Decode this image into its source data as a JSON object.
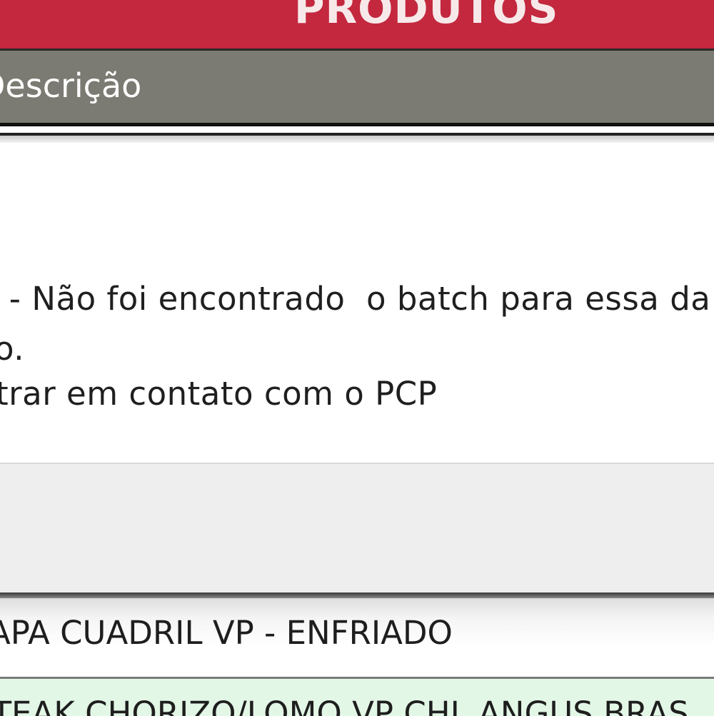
{
  "header": {
    "title": "PRODUTOS"
  },
  "table": {
    "column_header": "Descrição"
  },
  "message": {
    "lines": [
      " - Não foi encontrado  o batch para essa da",
      "o.",
      "trar em contato com o PCP"
    ]
  },
  "rows": [
    {
      "description": "TAPA CUADRIL VP - ENFRIADO"
    },
    {
      "description": "STEAK CHORIZO/LOMO VP CHL ANGUS BRAS"
    }
  ],
  "colors": {
    "title_bar": "#c3283f",
    "column_header": "#7c7b73",
    "selected_row": "#e3f7e6"
  }
}
